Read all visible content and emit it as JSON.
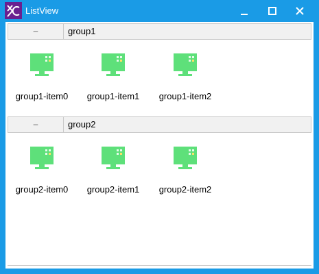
{
  "window": {
    "title": "ListView",
    "controls": [
      "minimize",
      "maximize",
      "close"
    ]
  },
  "colors": {
    "titlebar": "#1a9be6",
    "logo_background": "#6a1f8f",
    "item_icon": "#5ee07a",
    "group_header": "#f1f1f1"
  },
  "groups": [
    {
      "toggle": "–",
      "title": "group1",
      "items": [
        {
          "label": "group1-item0",
          "icon": "monitor-icon"
        },
        {
          "label": "group1-item1",
          "icon": "monitor-icon"
        },
        {
          "label": "group1-item2",
          "icon": "monitor-icon"
        }
      ]
    },
    {
      "toggle": "–",
      "title": "group2",
      "items": [
        {
          "label": "group2-item0",
          "icon": "monitor-icon"
        },
        {
          "label": "group2-item1",
          "icon": "monitor-icon"
        },
        {
          "label": "group2-item2",
          "icon": "monitor-icon"
        }
      ]
    }
  ]
}
